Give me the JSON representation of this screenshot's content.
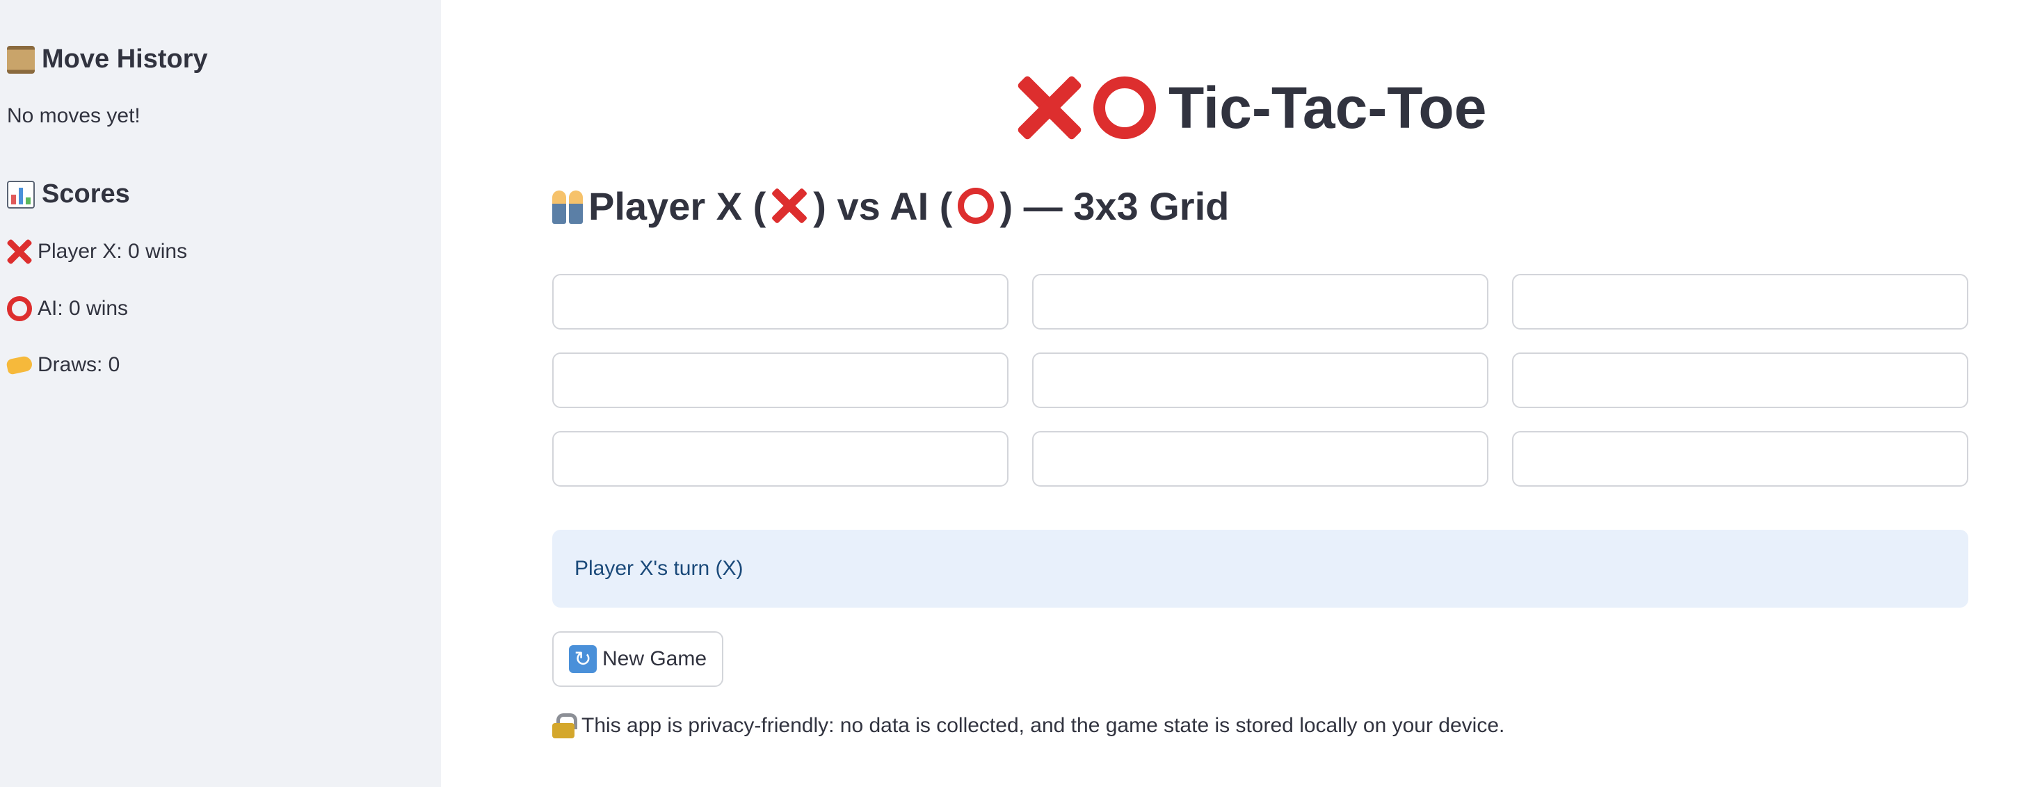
{
  "sidebar": {
    "move_history": {
      "icon": "scroll-icon",
      "title": "Move History",
      "empty_text": "No moves yet!"
    },
    "scores": {
      "icon": "bar-chart-icon",
      "title": "Scores",
      "player_x": "Player X: 0 wins",
      "ai": "AI: 0 wins",
      "draws": "Draws: 0"
    }
  },
  "main": {
    "title": "Tic-Tac-Toe",
    "subtitle": {
      "part1": "Player X (",
      "part2": ") vs AI (",
      "part3": ") — 3x3 Grid"
    },
    "board": {
      "cells": [
        "",
        "",
        "",
        "",
        "",
        "",
        "",
        "",
        ""
      ]
    },
    "status": "Player X's turn (X)",
    "new_game_label": "New Game",
    "privacy_note": "This app is privacy-friendly: no data is collected, and the game state is stored locally on your device."
  },
  "colors": {
    "accent_red": "#dd2e2e",
    "sidebar_bg": "#f0f2f6",
    "status_bg": "#e8f0fb",
    "status_text": "#1b4a7a",
    "text": "#31333f"
  }
}
